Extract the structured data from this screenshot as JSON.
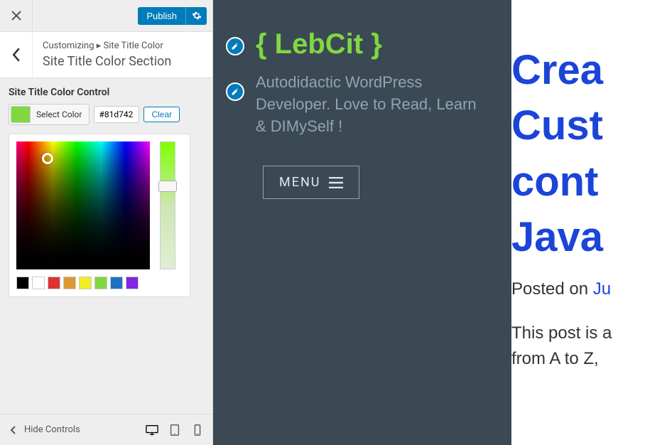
{
  "topbar": {
    "publish_label": "Publish"
  },
  "breadcrumb": {
    "root": "Customizing",
    "sep": "▸",
    "current": "Site Title Color"
  },
  "section": {
    "title": "Site Title Color Section"
  },
  "control": {
    "label": "Site Title Color Control",
    "select_color": "Select Color",
    "hex_value": "#81d742",
    "clear": "Clear"
  },
  "palette": [
    "#000000",
    "#ffffff",
    "#dd3333",
    "#dd9933",
    "#eeee22",
    "#81d742",
    "#1e73be",
    "#8224e3"
  ],
  "footer": {
    "hide_controls": "Hide Controls"
  },
  "preview": {
    "site_title": "{ LebCit }",
    "tagline": "Autodidactic WordPress Developer. Love to Read, Learn & DIMySelf !",
    "menu": "MENU",
    "post_title_lines": [
      "Crea",
      "Cust",
      "cont",
      "Java"
    ],
    "posted_on": "Posted on ",
    "posted_date_prefix": "Ju",
    "body_line1": "This post is a",
    "body_line2": "from A to Z,"
  }
}
